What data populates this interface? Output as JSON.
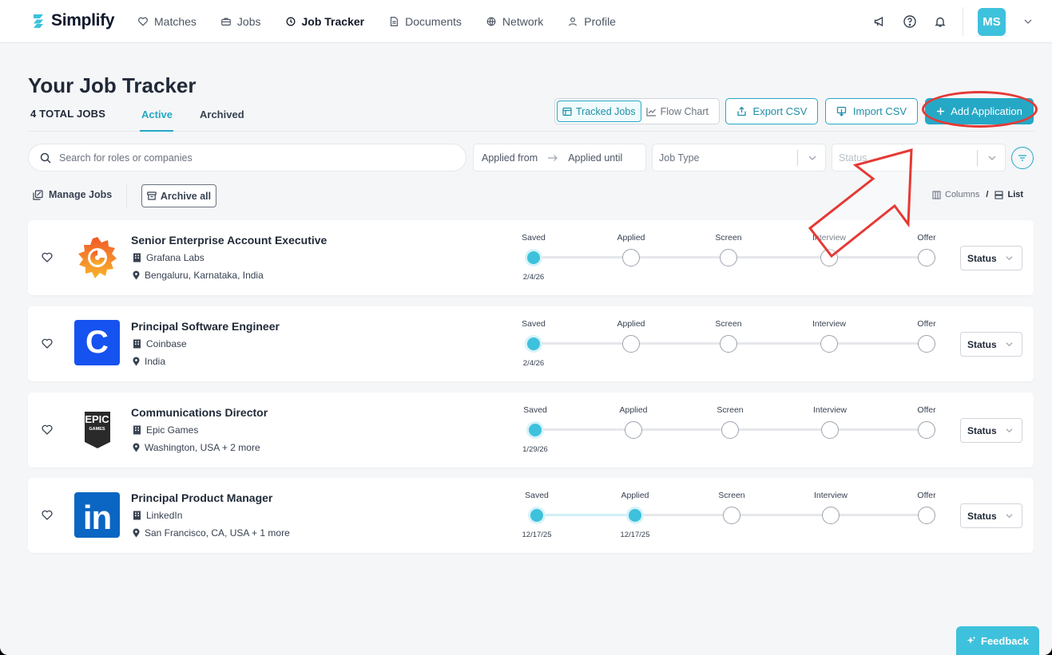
{
  "nav": {
    "brand": "Simplify",
    "links": [
      {
        "label": "Matches",
        "icon": "heart-icon"
      },
      {
        "label": "Jobs",
        "icon": "briefcase-icon"
      },
      {
        "label": "Job Tracker",
        "icon": "tracker-icon",
        "active": true
      },
      {
        "label": "Documents",
        "icon": "document-icon"
      },
      {
        "label": "Network",
        "icon": "network-icon"
      },
      {
        "label": "Profile",
        "icon": "user-icon"
      }
    ],
    "avatar": "MS"
  },
  "header": {
    "title": "Your Job Tracker",
    "total_jobs": "4 TOTAL JOBS",
    "tab_active": "Active",
    "tab_archived": "Archived"
  },
  "toolbar": {
    "tracked_jobs": "Tracked Jobs",
    "flow_chart": "Flow Chart",
    "export_csv": "Export CSV",
    "import_csv": "Import CSV",
    "add_application": "Add Application"
  },
  "filters": {
    "search_placeholder": "Search for roles or companies",
    "applied_from": "Applied from",
    "applied_until": "Applied until",
    "job_type": "Job Type",
    "status": "Status"
  },
  "actions": {
    "manage_jobs": "Manage Jobs",
    "archive_all": "Archive all",
    "columns": "Columns",
    "slash": "/",
    "list": "List"
  },
  "stages": [
    "Saved",
    "Applied",
    "Screen",
    "Interview",
    "Offer"
  ],
  "jobs": [
    {
      "title": "Senior Enterprise Account Executive",
      "company": "Grafana Labs",
      "location": "Bengaluru, Karnataka, India",
      "dates": [
        "2/4/26"
      ],
      "status": "Status"
    },
    {
      "title": "Principal Software Engineer",
      "company": "Coinbase",
      "location": "India",
      "dates": [
        "2/4/26"
      ],
      "status": "Status"
    },
    {
      "title": "Communications Director",
      "company": "Epic Games",
      "location": "Washington, USA + 2 more",
      "dates": [
        "1/29/26"
      ],
      "status": "Status"
    },
    {
      "title": "Principal Product Manager",
      "company": "LinkedIn",
      "location": "San Francisco, CA, USA + 1 more",
      "dates": [
        "12/17/25",
        "12/17/25"
      ],
      "status": "Status"
    }
  ],
  "logos": {
    "epic_line1": "EPIC",
    "epic_line2": "GAMES",
    "coinbase": "C",
    "linkedin": "in"
  },
  "feedback": "Feedback",
  "colors": {
    "accent": "#25a8c6",
    "dot": "#3ec1dc",
    "annotation": "#e53935"
  }
}
